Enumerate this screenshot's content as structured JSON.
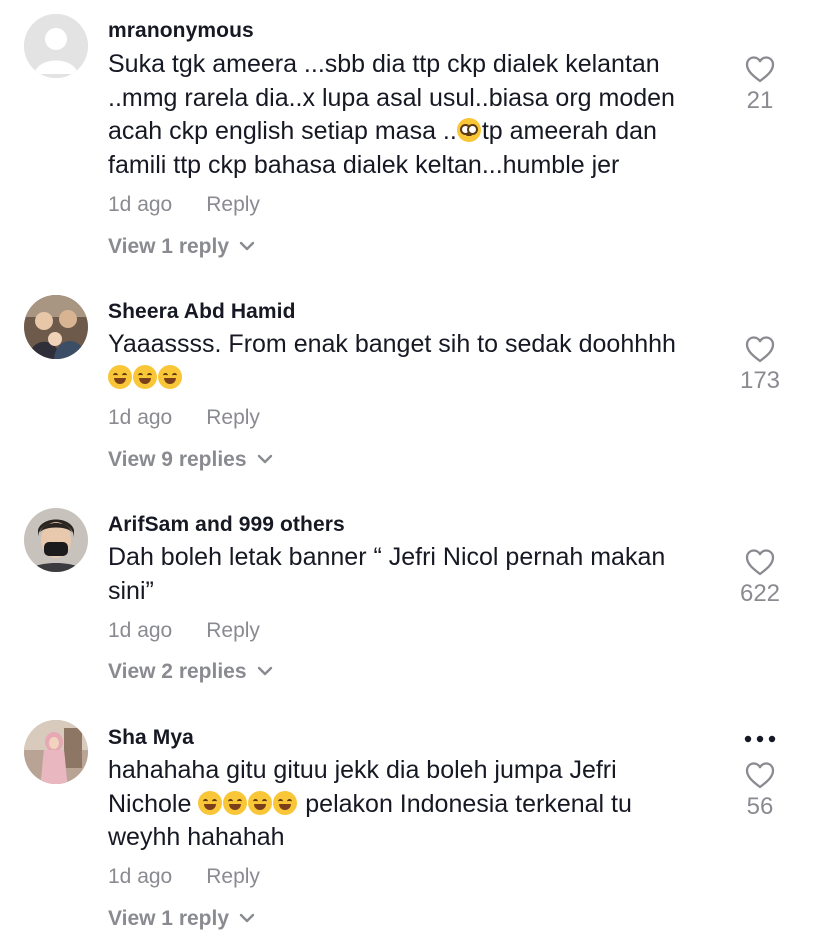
{
  "comments": [
    {
      "username": "mranonymous",
      "lines": [
        "Suka tgk ameera ...sbb dia ttp ckp dialek kelantan",
        "..mmg rarela dia..x lupa asal usul..biasa org moden",
        [
          "acah ckp english setiap masa ..",
          "tp ameerah dan"
        ],
        "famili ttp ckp bahasa dialek keltan...humble jer"
      ],
      "time": "1d ago",
      "reply_label": "Reply",
      "view_replies": "View 1 reply",
      "likes": "21",
      "avatar": "default-avatar"
    },
    {
      "username": "Sheera Abd Hamid",
      "lines": [
        "Yaaassss. From enak banget sih to sedak doohhhh"
      ],
      "emoji_count": 3,
      "time": "1d ago",
      "reply_label": "Reply",
      "view_replies": "View 9 replies",
      "likes": "173",
      "avatar": "photo-avatar"
    },
    {
      "username": "ArifSam and 999 others",
      "lines": [
        "Dah boleh letak banner “ Jefri Nicol pernah makan",
        "sini”"
      ],
      "time": "1d ago",
      "reply_label": "Reply",
      "view_replies": "View 2 replies",
      "likes": "622",
      "avatar": "photo-avatar"
    },
    {
      "username": "Sha Mya",
      "lines": [
        "hahahaha gitu gituu jekk dia boleh jumpa Jefri",
        [
          "Nichole ",
          " pelakon Indonesia terkenal tu"
        ],
        "weyhh hahahah"
      ],
      "emoji_count": 4,
      "time": "1d ago",
      "reply_label": "Reply",
      "view_replies": "View 1 reply",
      "likes": "56",
      "avatar": "photo-avatar",
      "has_more_menu": true
    }
  ],
  "colors": {
    "primary_text": "#161823",
    "secondary_text": "#8a8b91",
    "background": "#ffffff"
  }
}
